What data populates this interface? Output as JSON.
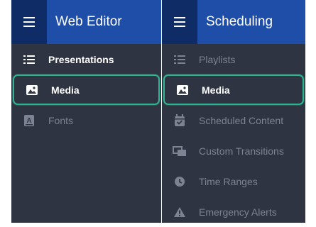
{
  "left_panel": {
    "title": "Web Editor",
    "items": [
      {
        "label": "Presentations",
        "icon": "list-icon",
        "state": "bold"
      },
      {
        "label": "Media",
        "icon": "image-icon",
        "state": "active"
      },
      {
        "label": "Fonts",
        "icon": "font-icon",
        "state": "normal"
      }
    ]
  },
  "right_panel": {
    "title": "Scheduling",
    "items": [
      {
        "label": "Playlists",
        "icon": "list-icon",
        "state": "normal"
      },
      {
        "label": "Media",
        "icon": "image-icon",
        "state": "active"
      },
      {
        "label": "Scheduled Content",
        "icon": "calendar-check-icon",
        "state": "normal"
      },
      {
        "label": "Custom Transitions",
        "icon": "transition-icon",
        "state": "normal"
      },
      {
        "label": "Time Ranges",
        "icon": "clock-icon",
        "state": "normal"
      },
      {
        "label": "Emergency Alerts",
        "icon": "warning-icon",
        "state": "normal"
      }
    ]
  },
  "colors": {
    "panel_bg": "#2f3442",
    "header_bg": "#1f4ea8",
    "menu_button_bg": "#0f2c66",
    "active_border": "#2fb48f",
    "muted_text": "#7c8392",
    "bright_text": "#ffffff"
  }
}
